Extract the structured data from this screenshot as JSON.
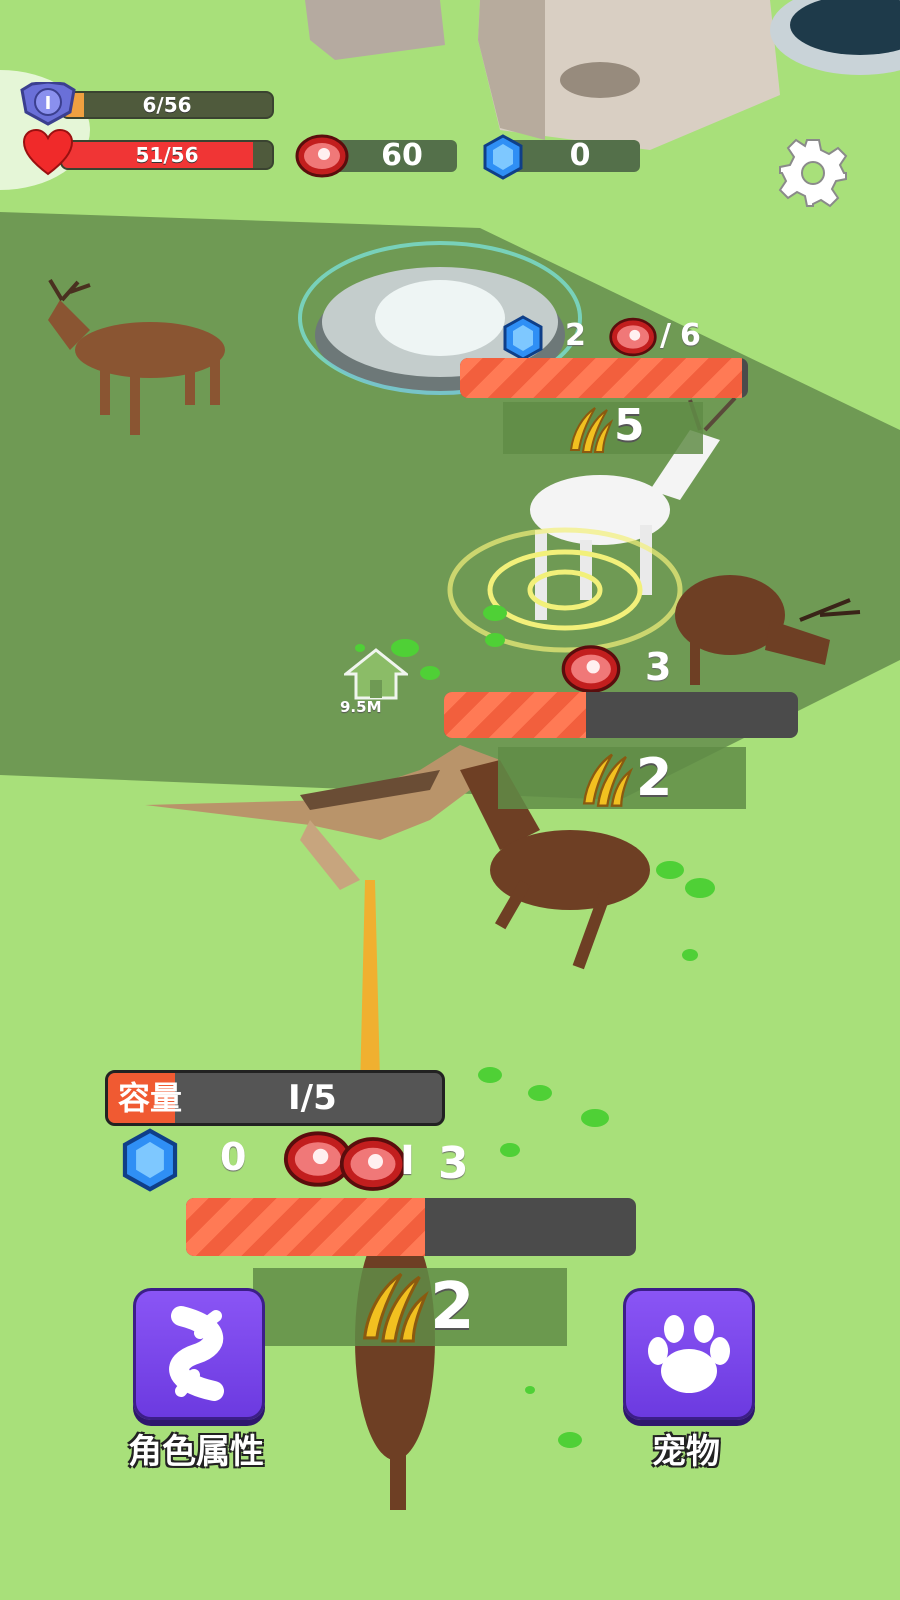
{
  "hud": {
    "level": {
      "badge": "I",
      "text": "6/56",
      "fraction": 0.107
    },
    "health": {
      "text": "51/56",
      "fraction": 0.91
    },
    "meat_count": "60",
    "gem_count": "0"
  },
  "colors": {
    "grass": "#a8e07a",
    "zone": "#6f9a54",
    "health_red": "#f03535",
    "bar_stripe": "#ff7a55",
    "button_purple": "#7b46ea"
  },
  "icons": {
    "settings": "gear-icon",
    "level": "shield-badge-icon",
    "health": "heart-icon",
    "meat": "meat-icon",
    "gem": "gem-icon",
    "claw": "claw-icon",
    "home": "home-icon",
    "stats": "dna-icon",
    "pet": "paw-icon"
  },
  "enemy_white_deer": {
    "gem_count": "2",
    "meat_count": "6",
    "separator": "/",
    "health_fraction": 0.98,
    "claw_level": "5"
  },
  "enemy_brown_deer": {
    "meat_count": "3",
    "health_fraction": 0.4,
    "claw_level": "2"
  },
  "home_marker": {
    "distance": "9.5M"
  },
  "player": {
    "capacity_label": "容量",
    "capacity_value": "I/5",
    "capacity_fraction": 0.2,
    "gem_count": "0",
    "meat_count": "I",
    "meat_count_overlap": "3",
    "health_fraction": 0.53,
    "claw_level": "2"
  },
  "buttons": {
    "stats_label": "角色属性",
    "pet_label": "宠物"
  }
}
